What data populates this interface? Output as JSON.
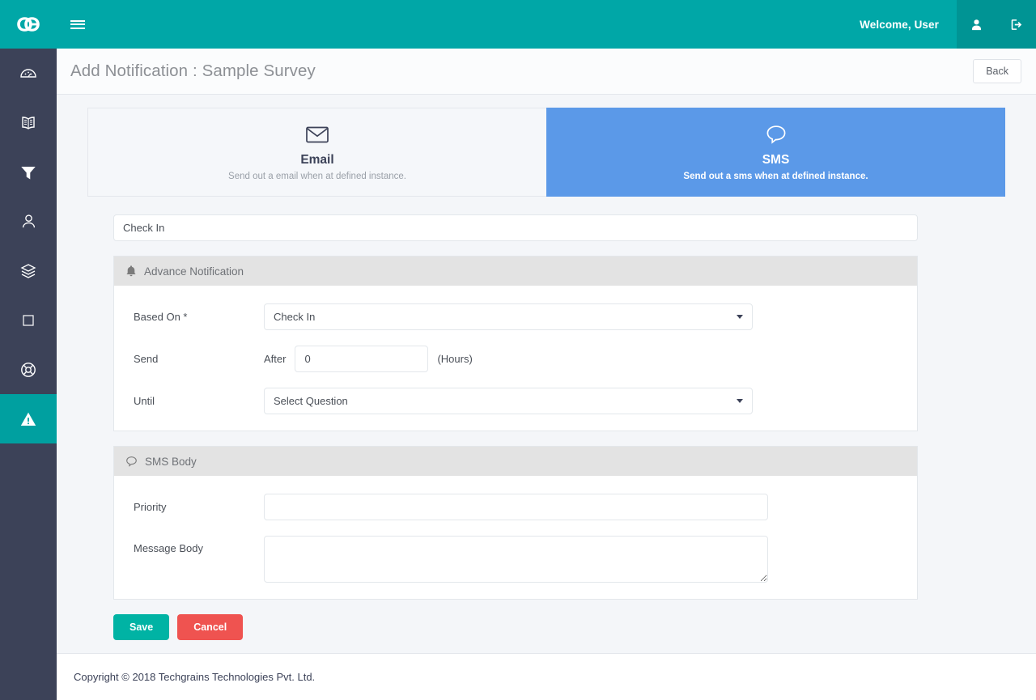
{
  "topbar": {
    "logo": "go-logo",
    "menu_icon": "hamburger-menu-icon",
    "welcome": "Welcome, User",
    "user_icon": "user-icon",
    "logout_icon": "logout-icon"
  },
  "sidebar": {
    "items": [
      {
        "icon": "dashboard-icon",
        "active": false
      },
      {
        "icon": "book-icon",
        "active": false
      },
      {
        "icon": "filter-icon",
        "active": false
      },
      {
        "icon": "user-icon",
        "active": false
      },
      {
        "icon": "layers-icon",
        "active": false
      },
      {
        "icon": "square-icon",
        "active": false
      },
      {
        "icon": "lifebuoy-icon",
        "active": false
      },
      {
        "icon": "warning-icon",
        "active": true
      }
    ]
  },
  "header": {
    "title": "Add Notification : Sample Survey",
    "back_label": "Back"
  },
  "tabs": [
    {
      "id": "email",
      "icon": "envelope-icon",
      "label": "Email",
      "sub": "Send out a email when at defined instance.",
      "active": false
    },
    {
      "id": "sms",
      "icon": "speech-bubble-icon",
      "label": "SMS",
      "sub": "Send out a sms when at defined instance.",
      "active": true
    }
  ],
  "form": {
    "name_value": "Check In",
    "name_placeholder": "",
    "advance_panel": {
      "icon": "bell-icon",
      "title": "Advance Notification",
      "based_on_label": "Based On *",
      "based_on_value": "Check In",
      "send_label": "Send",
      "after_label": "After",
      "after_value": "0",
      "hours_label": "(Hours)",
      "until_label": "Until",
      "until_value": "Select Question"
    },
    "body_panel": {
      "icon": "speech-bubble-icon",
      "title": "SMS Body",
      "priority_label": "Priority",
      "priority_value": "",
      "priority_placeholder": "",
      "message_label": "Message Body",
      "message_value": "",
      "message_placeholder": ""
    },
    "save_label": "Save",
    "cancel_label": "Cancel"
  },
  "footer": {
    "copyright": "Copyright © 2018 Techgrains Technologies Pvt. Ltd."
  },
  "colors": {
    "brand_teal": "#00a7a7",
    "sidebar_navy": "#3c4258",
    "active_tab_blue": "#5b99e8",
    "save_teal": "#00b3a4",
    "cancel_red": "#ef5350",
    "panel_head_gray": "#e3e3e3"
  }
}
